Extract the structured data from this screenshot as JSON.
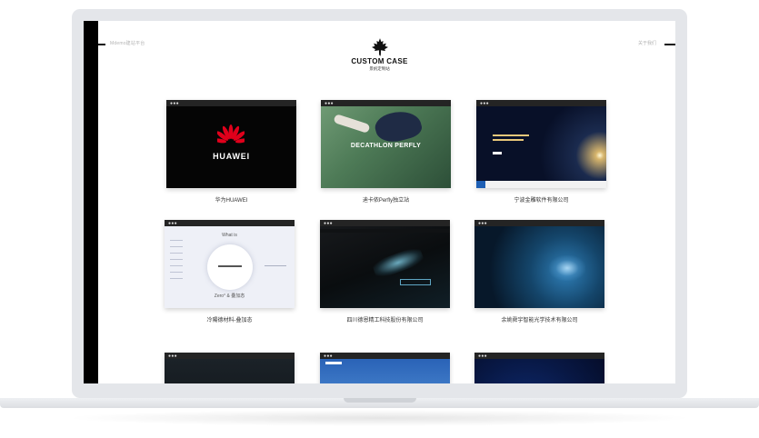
{
  "site": {
    "nav_left": "Mdemo建站平台",
    "nav_right": "关于我们",
    "logo_title": "CUSTOM CASE",
    "logo_subtitle": "景帆定制站"
  },
  "cases": [
    {
      "caption": "华为HUAWEI",
      "thumb_text": "HUAWEI"
    },
    {
      "caption": "迪卡侬Perfly独立站",
      "thumb_text": "DECATHLON PERFLY"
    },
    {
      "caption": "宁波金雕软件有限公司",
      "thumb_text": ""
    },
    {
      "caption": "冷陽德材料-叠加态",
      "thumb_text_top": "What is",
      "thumb_text_bottom": "Zero° & 叠加态"
    },
    {
      "caption": "四川德恩精工科技股份有限公司",
      "thumb_text": ""
    },
    {
      "caption": "余姚舜宇智能光学技术有限公司",
      "thumb_text": ""
    },
    {
      "caption": ""
    },
    {
      "caption": ""
    },
    {
      "caption": ""
    }
  ],
  "colors": {
    "huawei_red": "#e0001b",
    "side_bar": "#000000",
    "caption_text": "#333333"
  }
}
